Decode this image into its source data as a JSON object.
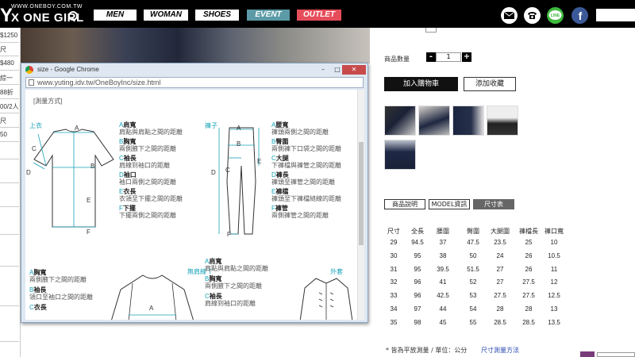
{
  "header": {
    "logo_url": "WWW.ONEBOY.COM.TW",
    "logo_y": "Y",
    "logo_name": "X ONE GIRL",
    "nav": [
      "MEN",
      "WOMAN",
      "SHOES",
      "EVENT",
      "OUTLET"
    ],
    "social_icons": [
      "mail-icon",
      "phone-icon",
      "line-icon",
      "facebook-icon"
    ],
    "line_label": "LINE",
    "facebook_label": "f",
    "colors": {
      "event": "#5b9aa6",
      "outlet": "#e64d5a",
      "line": "#3db93d",
      "facebook": "#3b5998"
    }
  },
  "left_column": {
    "items": [
      "$1250",
      "尺",
      "$480",
      "綜一",
      "88折",
      "00/2人",
      "尺",
      "50"
    ]
  },
  "product_panel": {
    "qty_label": "商品數量",
    "qty_minus": "-",
    "qty_value": "1",
    "qty_plus": "+",
    "add_to_cart": "加入購物車",
    "add_to_favorites": "添加收藏",
    "tabs": [
      "商品說明",
      "MODEL資訊",
      "尺寸表"
    ],
    "active_tab": 2,
    "size_table": {
      "headers": [
        "尺寸",
        "全長",
        "腰圍",
        "臀圍",
        "大腿圍",
        "褲檔長",
        "褲口寬"
      ],
      "rows": [
        [
          "29",
          "94.5",
          "37",
          "47.5",
          "23.5",
          "25",
          "10"
        ],
        [
          "30",
          "95",
          "38",
          "50",
          "24",
          "26",
          "10.5"
        ],
        [
          "31",
          "95",
          "39.5",
          "51.5",
          "27",
          "26",
          "11"
        ],
        [
          "32",
          "96",
          "41",
          "52",
          "27",
          "27.5",
          "12"
        ],
        [
          "33",
          "96",
          "42.5",
          "53",
          "27.5",
          "27.5",
          "12.5"
        ],
        [
          "34",
          "97",
          "44",
          "54",
          "28",
          "28",
          "13"
        ],
        [
          "35",
          "98",
          "45",
          "55",
          "28.5",
          "28.5",
          "13.5"
        ]
      ]
    },
    "note": "* 皆為平放測量 / 單位：公分",
    "note_link": "尺寸測量方法"
  },
  "popup": {
    "title": "size - Google Chrome",
    "minimize": "–",
    "maximize": "□",
    "close": "✕",
    "address": "www.yuting.idv.tw/OneBoyInc/size.html",
    "heading": "[測量方式]",
    "top_label": "上衣",
    "pants_label": "褲子",
    "raglan_label": "無肩線 T",
    "jacket_label": "外套",
    "top_legend": [
      {
        "k": "A",
        "t": "肩寬",
        "d": "肩點與肩點之間的距離"
      },
      {
        "k": "B",
        "t": "胸寬",
        "d": "兩側腋下之間的距離"
      },
      {
        "k": "C",
        "t": "袖長",
        "d": "肩線到袖口的距離"
      },
      {
        "k": "D",
        "t": "袖口",
        "d": "袖口兩側之間的距離"
      },
      {
        "k": "E",
        "t": "衣長",
        "d": "衣領至下擺之間的距離"
      },
      {
        "k": "F",
        "t": "下擺",
        "d": "下擺兩側之間的距離"
      }
    ],
    "pants_legend": [
      {
        "k": "A",
        "t": "腰寬",
        "d": "褲頭兩側之間的距離"
      },
      {
        "k": "B",
        "t": "臀圍",
        "d": "兩側褲下口袋之間的距離"
      },
      {
        "k": "C",
        "t": "大腿",
        "d": "下褲檔與褲管之間的距離"
      },
      {
        "k": "D",
        "t": "褲長",
        "d": "褲頭至褲管之間的距離"
      },
      {
        "k": "E",
        "t": "褲檔",
        "d": "褲頭至下褲檔縫線的距離"
      },
      {
        "k": "F",
        "t": "褲管",
        "d": "兩側褲管之間的距離"
      }
    ],
    "raglan_legend": [
      {
        "k": "A",
        "t": "胸寬",
        "d": "兩側腋下之間的距離"
      },
      {
        "k": "B",
        "t": "袖長",
        "d": "領口至袖口之間的距離"
      },
      {
        "k": "C",
        "t": "衣長",
        "d": ""
      }
    ],
    "jacket_legend": [
      {
        "k": "A",
        "t": "肩寬",
        "d": "肩點與肩點之間的距離"
      },
      {
        "k": "B",
        "t": "胸寬",
        "d": "兩側腋下之間的距離"
      },
      {
        "k": "C",
        "t": "袖長",
        "d": "肩線到袖口的距離"
      }
    ],
    "top_diagram_letters": [
      "A",
      "B",
      "C",
      "D",
      "E",
      "F"
    ],
    "pants_diagram_letters": [
      "A",
      "B",
      "C",
      "D",
      "E",
      "F"
    ],
    "raglan_diagram_letters": [
      "A"
    ],
    "accent": "#17a2b8"
  }
}
